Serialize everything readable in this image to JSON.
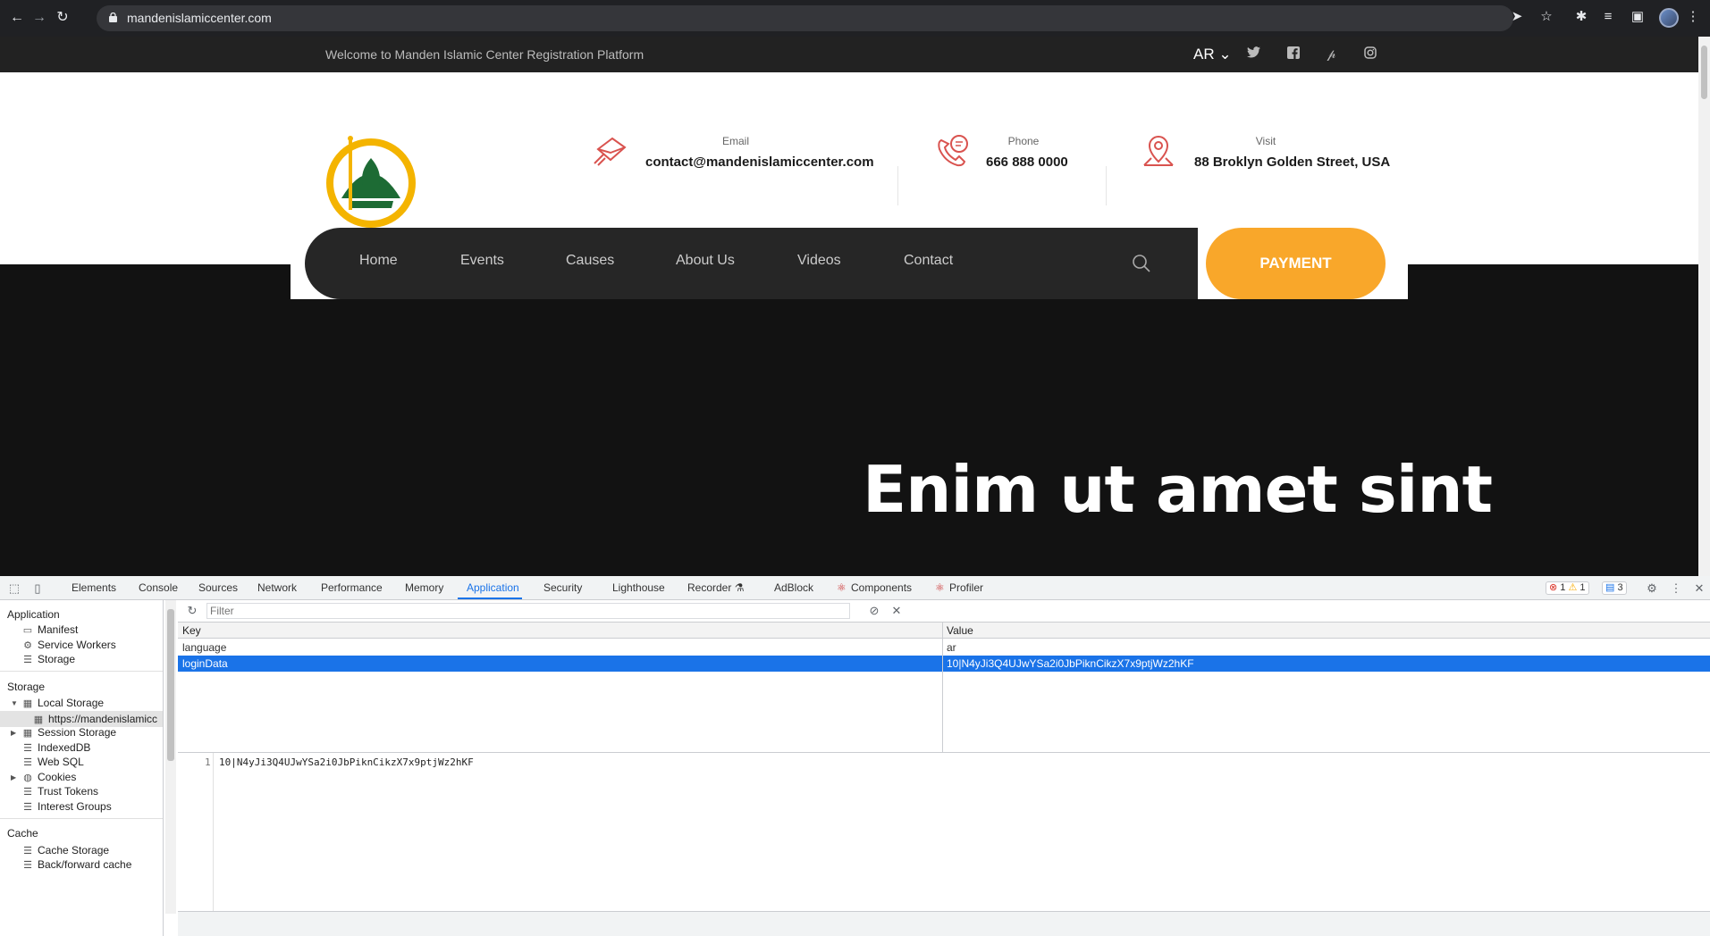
{
  "browser": {
    "url": "mandenislamiccenter.com",
    "icons": [
      "back-icon",
      "forward-icon",
      "reload-icon",
      "send-icon",
      "star-icon",
      "extensions-icon",
      "media-icon",
      "sidepanel-icon",
      "menu-icon"
    ]
  },
  "site": {
    "topbar": {
      "welcome": "Welcome to Manden Islamic Center Registration Platform",
      "lang": "AR ⌄",
      "social": [
        "twitter-icon",
        "facebook-icon",
        "pinterest-icon",
        "instagram-icon"
      ]
    },
    "contact": {
      "email_label": "Email",
      "email_value": "contact@mandenislamiccenter.com",
      "phone_label": "Phone",
      "phone_value": "666 888 0000",
      "visit_label": "Visit",
      "visit_value": "88 Broklyn Golden Street, USA"
    },
    "nav": {
      "items": [
        "Home",
        "Events",
        "Causes",
        "About Us",
        "Videos",
        "Contact"
      ],
      "payment": "PAYMENT"
    },
    "hero_title": "Enim ut amet sint",
    "colors": {
      "accent": "#f9a72a",
      "icon_red": "#d9534f"
    }
  },
  "devtools": {
    "tabs": [
      "Elements",
      "Console",
      "Sources",
      "Network",
      "Performance",
      "Memory",
      "Application",
      "Security",
      "Lighthouse",
      "Recorder ⚗",
      "AdBlock",
      "Components",
      "Profiler"
    ],
    "active_tab": "Application",
    "badges": {
      "errors": "1",
      "warnings": "1",
      "messages": "3"
    },
    "sidebar": {
      "application_title": "Application",
      "application_items": [
        "Manifest",
        "Service Workers",
        "Storage"
      ],
      "storage_title": "Storage",
      "local_storage": "Local Storage",
      "local_origin": "https://mandenislamicc",
      "storage_items": [
        "Session Storage",
        "IndexedDB",
        "Web SQL",
        "Cookies",
        "Trust Tokens",
        "Interest Groups"
      ],
      "cache_title": "Cache",
      "cache_items": [
        "Cache Storage",
        "Back/forward cache"
      ]
    },
    "filter_placeholder": "Filter",
    "table": {
      "headers": {
        "key": "Key",
        "value": "Value"
      },
      "rows": [
        {
          "key": "language",
          "value": "ar"
        },
        {
          "key": "loginData",
          "value": "10|N4yJi3Q4UJwYSa2i0JbPiknCikzX7x9ptjWz2hKF"
        }
      ]
    },
    "preview": {
      "line_number": "1",
      "text": "10|N4yJi3Q4UJwYSa2i0JbPiknCikzX7x9ptjWz2hKF"
    }
  }
}
